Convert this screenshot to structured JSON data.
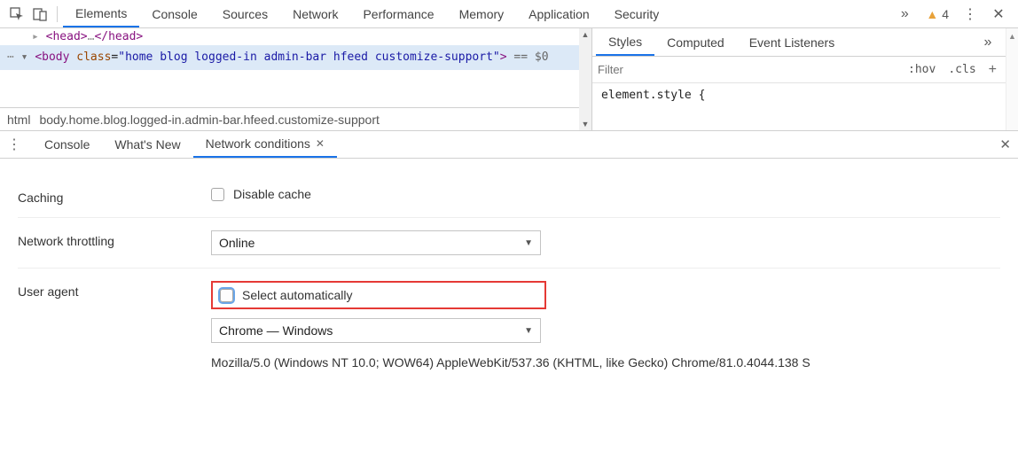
{
  "topTabs": [
    "Elements",
    "Console",
    "Sources",
    "Network",
    "Performance",
    "Memory",
    "Application",
    "Security"
  ],
  "topActive": "Elements",
  "warnCount": "4",
  "source": {
    "headLine": "<head>…</head>",
    "bodyOpen_tag": "body",
    "bodyOpen_attr": "class",
    "bodyOpen_val": "home blog logged-in admin-bar hfeed customize-support",
    "selMarker": "== $0"
  },
  "breadcrumb": [
    "html",
    "body.home.blog.logged-in.admin-bar.hfeed.customize-support"
  ],
  "stylesTabs": [
    "Styles",
    "Computed",
    "Event Listeners"
  ],
  "stylesActive": "Styles",
  "filterPlaceholder": "Filter",
  "hov": ":hov",
  "cls": ".cls",
  "styleBody": "element.style {",
  "drawerTabs": [
    "Console",
    "What's New",
    "Network conditions"
  ],
  "drawerActive": "Network conditions",
  "caching": {
    "label": "Caching",
    "chk": "Disable cache"
  },
  "throttle": {
    "label": "Network throttling",
    "value": "Online"
  },
  "ua": {
    "label": "User agent",
    "chk": "Select automatically",
    "value": "Chrome — Windows",
    "string": "Mozilla/5.0 (Windows NT 10.0; WOW64) AppleWebKit/537.36 (KHTML, like Gecko) Chrome/81.0.4044.138 S"
  }
}
